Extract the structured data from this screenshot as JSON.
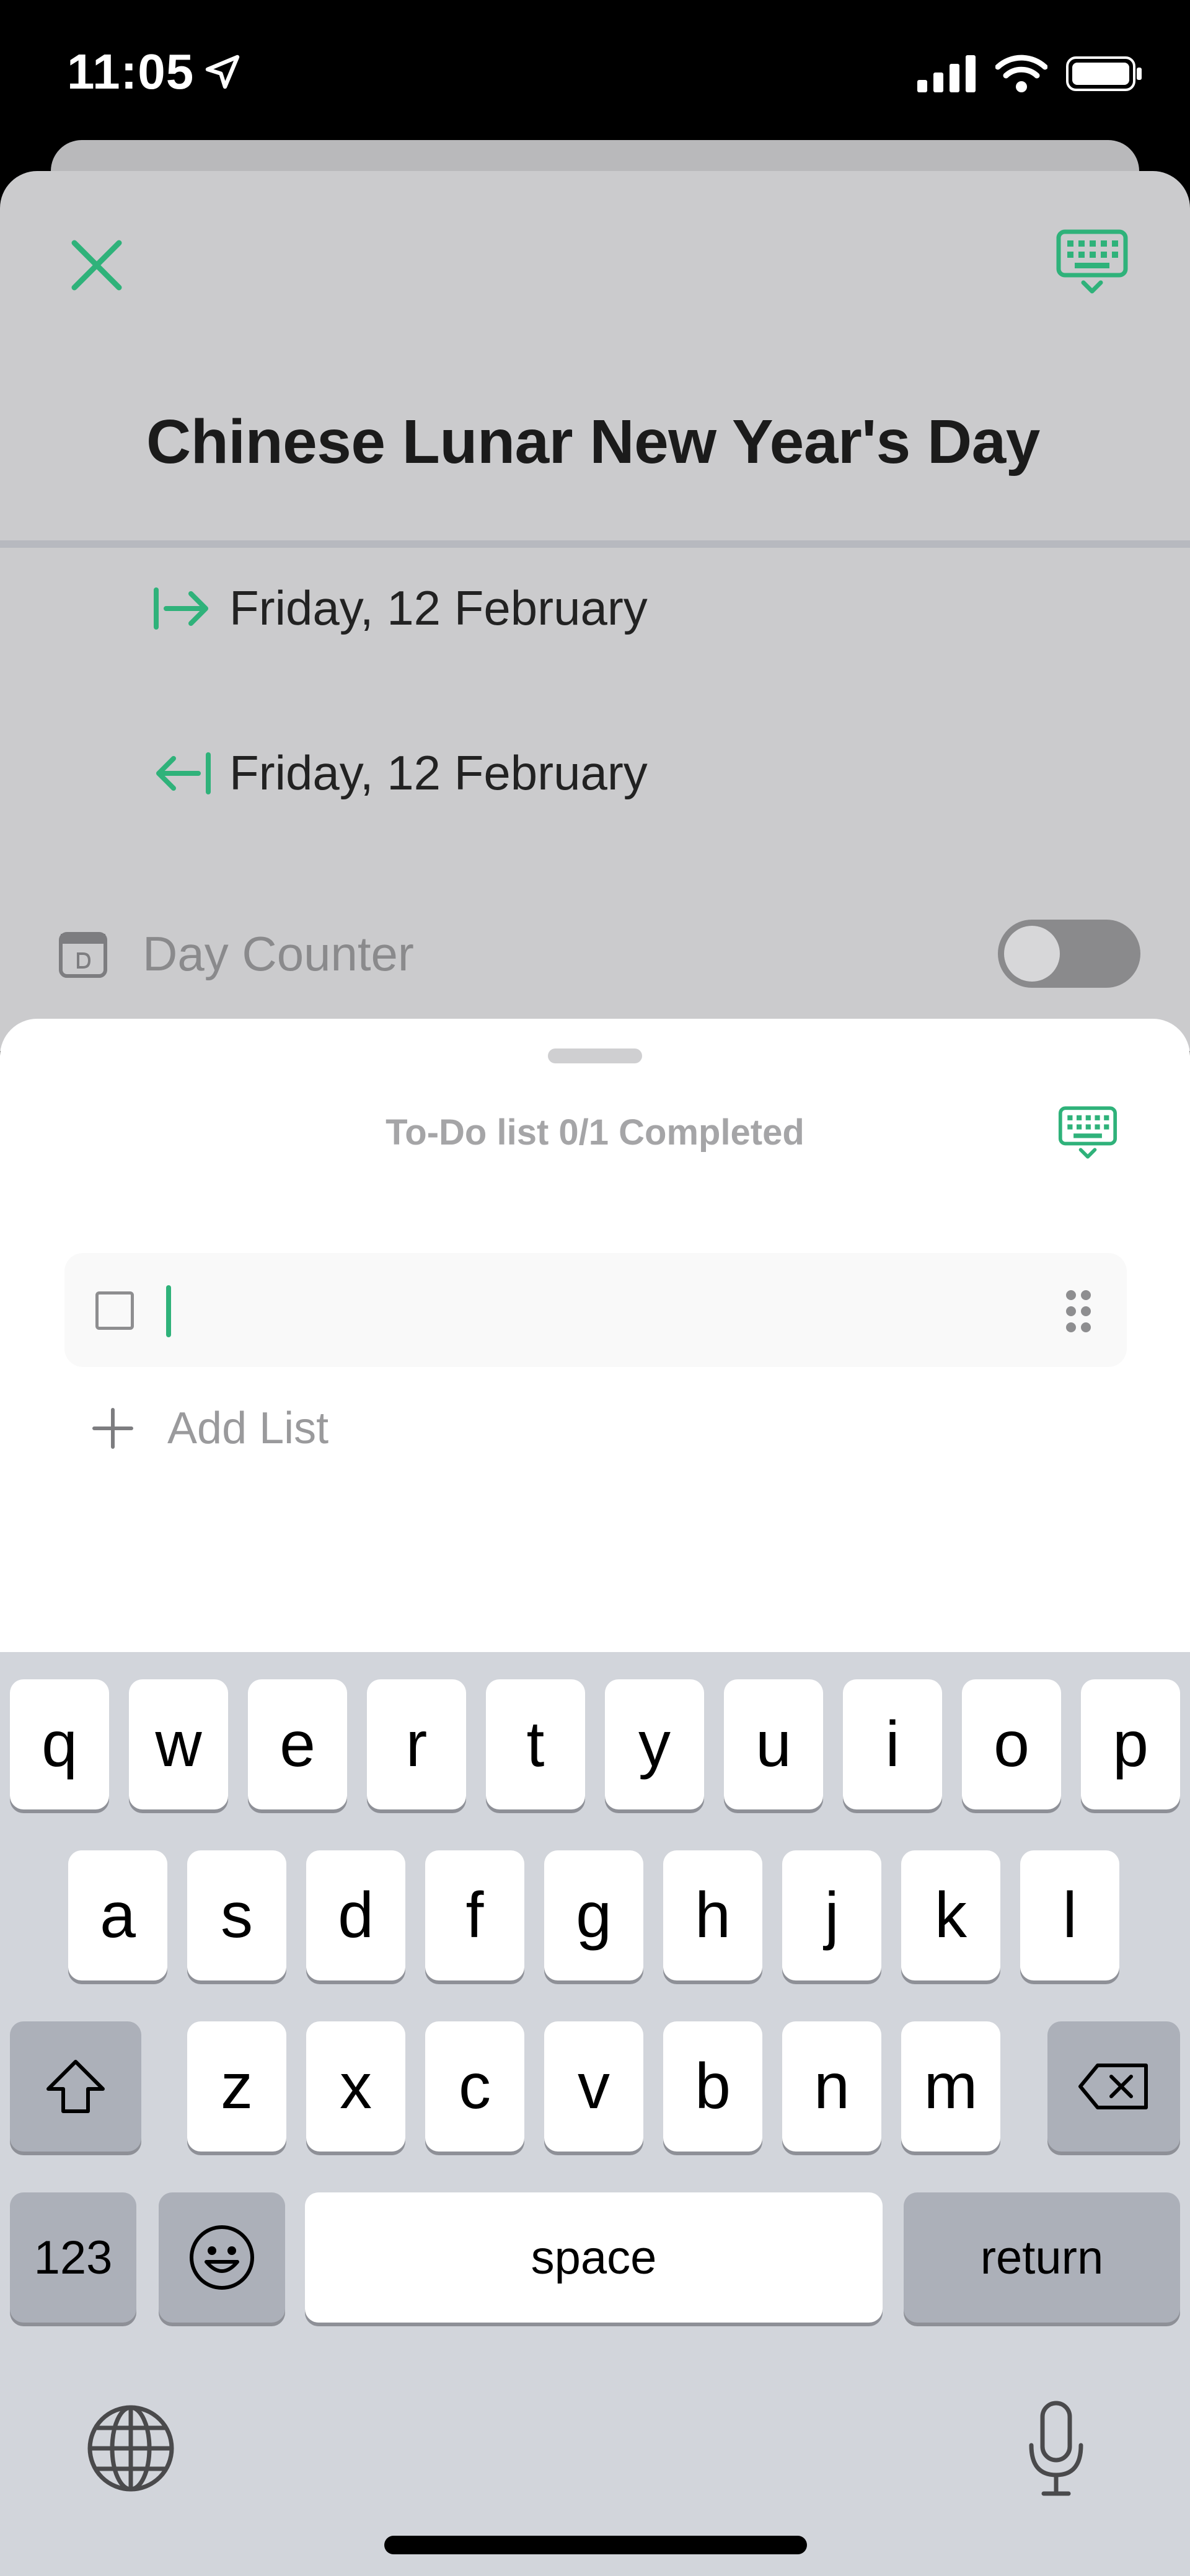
{
  "status_bar": {
    "time": "11:05"
  },
  "event": {
    "title": "Chinese Lunar New Year's Day",
    "start_date": "Friday, 12 February",
    "end_date": "Friday, 12 February",
    "day_counter_label": "Day Counter",
    "day_counter_on": false
  },
  "todo": {
    "title": "To-Do list 0/1 Completed",
    "item_value": "",
    "add_list_label": "Add List"
  },
  "keyboard": {
    "row1": [
      "q",
      "w",
      "e",
      "r",
      "t",
      "y",
      "u",
      "i",
      "o",
      "p"
    ],
    "row2": [
      "a",
      "s",
      "d",
      "f",
      "g",
      "h",
      "j",
      "k",
      "l"
    ],
    "row3": [
      "z",
      "x",
      "c",
      "v",
      "b",
      "n",
      "m"
    ],
    "numbers_label": "123",
    "space_label": "space",
    "return_label": "return"
  },
  "colors": {
    "accent": "#2fb27a",
    "sheet_dim": "#cbcbcd",
    "keyboard_bg": "#d2d5db"
  }
}
